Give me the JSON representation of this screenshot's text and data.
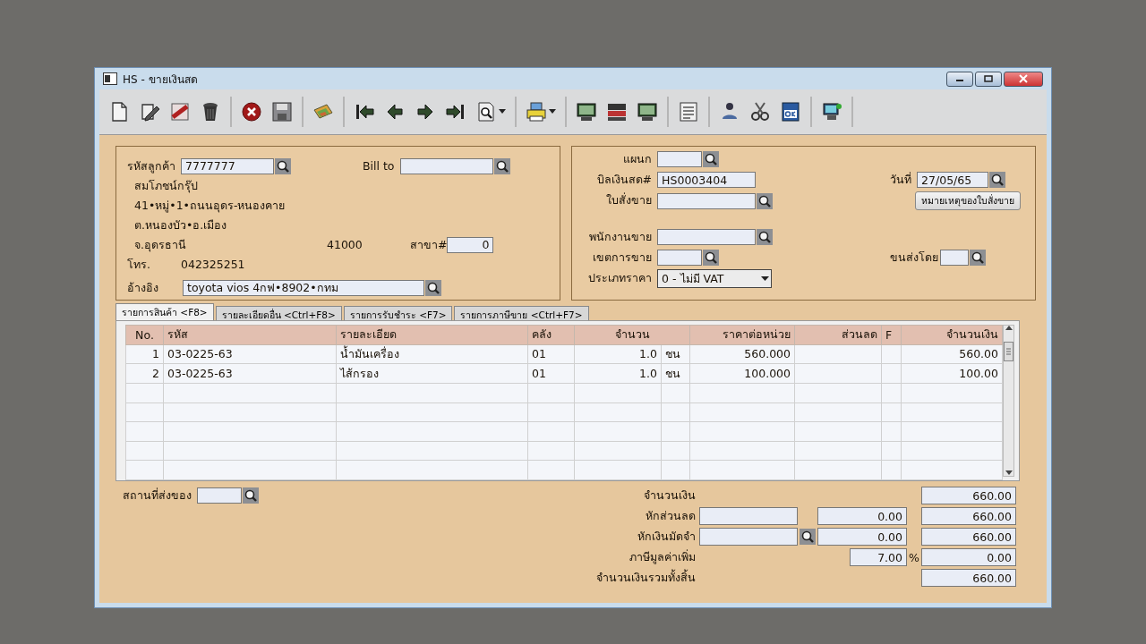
{
  "window": {
    "title": "HS - ขายเงินสด"
  },
  "toolbar": [
    {
      "items": [
        {
          "kind": "new",
          "dropdown": false
        },
        {
          "kind": "edit",
          "dropdown": false
        },
        {
          "kind": "void",
          "dropdown": false
        },
        {
          "kind": "delete",
          "dropdown": false
        }
      ]
    },
    {
      "items": [
        {
          "kind": "cancel",
          "dropdown": false
        },
        {
          "kind": "save",
          "dropdown": false
        }
      ]
    },
    {
      "items": [
        {
          "kind": "papers",
          "dropdown": false
        }
      ]
    },
    {
      "items": [
        {
          "kind": "first",
          "dropdown": false
        },
        {
          "kind": "prev",
          "dropdown": false
        },
        {
          "kind": "next",
          "dropdown": false
        },
        {
          "kind": "last",
          "dropdown": false
        },
        {
          "kind": "preview",
          "dropdown": true
        }
      ]
    },
    {
      "items": [
        {
          "kind": "print",
          "dropdown": true
        }
      ]
    },
    {
      "items": [
        {
          "kind": "monitor",
          "dropdown": false
        },
        {
          "kind": "register",
          "dropdown": false
        },
        {
          "kind": "monitor",
          "dropdown": false
        }
      ]
    },
    {
      "items": [
        {
          "kind": "list",
          "dropdown": false
        }
      ]
    },
    {
      "items": [
        {
          "kind": "person",
          "dropdown": false
        },
        {
          "kind": "scissors",
          "dropdown": false
        },
        {
          "kind": "ok",
          "dropdown": false
        }
      ]
    },
    {
      "items": [
        {
          "kind": "computer",
          "dropdown": false
        }
      ]
    }
  ],
  "customer": {
    "code_label": "รหัสลูกค้า",
    "code": "7777777",
    "bill_to_label": "Bill to",
    "name": "สมโภชน์กรุ๊ป",
    "address_1": "41•หมู่•1•ถนนอุดร-หนองคาย",
    "address_2": "ต.หนองบัว•อ.เมือง",
    "province": "จ.อุดรธานี",
    "postcode": "41000",
    "branch_label": "สาขา#",
    "branch": "0",
    "phone_label": "โทร.",
    "phone": "042325251",
    "reference_label": "อ้างอิง",
    "reference": "toyota vios 4กฟ•8902•กทม"
  },
  "document": {
    "department_label": "แผนก",
    "bill_label": "บิลเงินสด#",
    "bill_no": "HS0003404",
    "date_label": "วันที่",
    "date": "27/05/65",
    "order_label": "ใบสั่งขาย",
    "order_note_button": "หมายเหตุของใบสั่งขาย",
    "salesperson_label": "พนักงานขาย",
    "area_label": "เขตการขาย",
    "shipping_label": "ขนส่งโดย",
    "price_type_label": "ประเภทราคา",
    "price_type": "0 - ไม่มี VAT"
  },
  "tabs": [
    {
      "label": "รายการสินค้า <F8>",
      "selected": true
    },
    {
      "label": "รายละเอียดอื่น <Ctrl+F8>",
      "selected": false
    },
    {
      "label": "รายการรับชำระ <F7>",
      "selected": false
    },
    {
      "label": "รายการภาษีขาย <Ctrl+F7>",
      "selected": false
    }
  ],
  "table": {
    "columns": [
      "No.",
      "รหัส",
      "รายละเอียด",
      "คลัง",
      "จำนวน",
      "ราคาต่อหน่วย",
      "ส่วนลด",
      "F",
      "จำนวนเงิน"
    ],
    "rows": [
      {
        "no": "1",
        "code": "03-0225-63",
        "description": "น้ำมันเครื่อง",
        "warehouse": "01",
        "qty": "1.0",
        "unit": "ชน",
        "price": "560.000",
        "amount": "560.00"
      },
      {
        "no": "2",
        "code": "03-0225-63",
        "description": "ไส้กรอง",
        "warehouse": "01",
        "qty": "1.0",
        "unit": "ชน",
        "price": "100.000",
        "amount": "100.00"
      }
    ]
  },
  "delivery": {
    "label": "สถานที่ส่งของ"
  },
  "totals": [
    {
      "kind": "plain",
      "label": "จำนวนเงิน",
      "amount": "660.00"
    },
    {
      "kind": "discount",
      "label": "หักส่วนลด",
      "value": "0.00",
      "amount": "660.00"
    },
    {
      "kind": "deposit",
      "label": "หักเงินมัดจำ",
      "value": "0.00",
      "amount": "660.00"
    },
    {
      "kind": "vat",
      "label": "ภาษีมูลค่าเพิ่ม",
      "rate": "7.00",
      "unit": "%",
      "amount": "0.00"
    },
    {
      "kind": "plain",
      "label": "จำนวนเงินรวมทั้งสิ้น",
      "amount": "660.00"
    }
  ]
}
